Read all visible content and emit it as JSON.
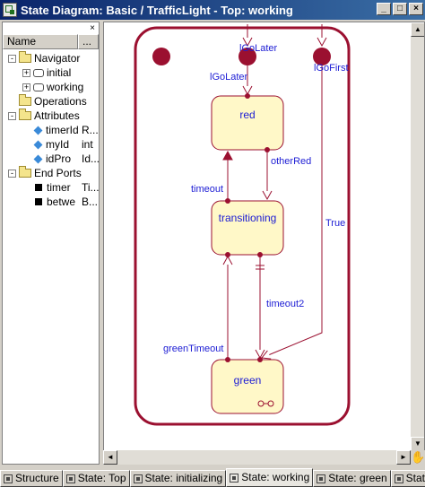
{
  "window": {
    "title": "State Diagram: Basic / TrafficLight - Top: working",
    "minimize": "_",
    "maximize": "□",
    "close": "×"
  },
  "sidebar": {
    "close": "×",
    "col_name": "Name",
    "col_more": "...",
    "items": [
      {
        "label": "Navigator",
        "kind": "folder",
        "expander": "-"
      },
      {
        "label": "initial",
        "kind": "state",
        "expander": "+"
      },
      {
        "label": "working",
        "kind": "state",
        "expander": "+"
      },
      {
        "label": "Operations",
        "kind": "folder",
        "expander": ""
      },
      {
        "label": "Attributes",
        "kind": "folder",
        "expander": "-"
      },
      {
        "label": "timerId",
        "kind": "attr",
        "extra": "R..."
      },
      {
        "label": "myId",
        "kind": "attr",
        "extra": "int"
      },
      {
        "label": "idPro",
        "kind": "attr",
        "extra": "Id..."
      },
      {
        "label": "End Ports",
        "kind": "folder",
        "expander": "-"
      },
      {
        "label": "timer",
        "kind": "port",
        "extra": "Ti..."
      },
      {
        "label": "betwe",
        "kind": "port",
        "extra": "B..."
      }
    ]
  },
  "diagram": {
    "states": {
      "red": "red",
      "transitioning": "transitioning",
      "green": "green"
    },
    "transitions": {
      "lgolater_top": "lGoLater",
      "lgolater_side": "lGoLater",
      "lgofirst": "lGoFirst",
      "otherred": "otherRed",
      "timeout": "timeout",
      "true": "True",
      "timeout2": "timeout2",
      "greentimeout": "greenTimeout"
    },
    "colors": {
      "border": "#9b1030",
      "state_fill": "#fff8c8",
      "label": "#1c1cd4"
    }
  },
  "tabs": [
    {
      "label": "Structure",
      "active": false
    },
    {
      "label": "State: Top",
      "active": false
    },
    {
      "label": "State: initializing",
      "active": false
    },
    {
      "label": "State: working",
      "active": true
    },
    {
      "label": "State: green",
      "active": false
    },
    {
      "label": "State: f...",
      "active": false
    }
  ]
}
